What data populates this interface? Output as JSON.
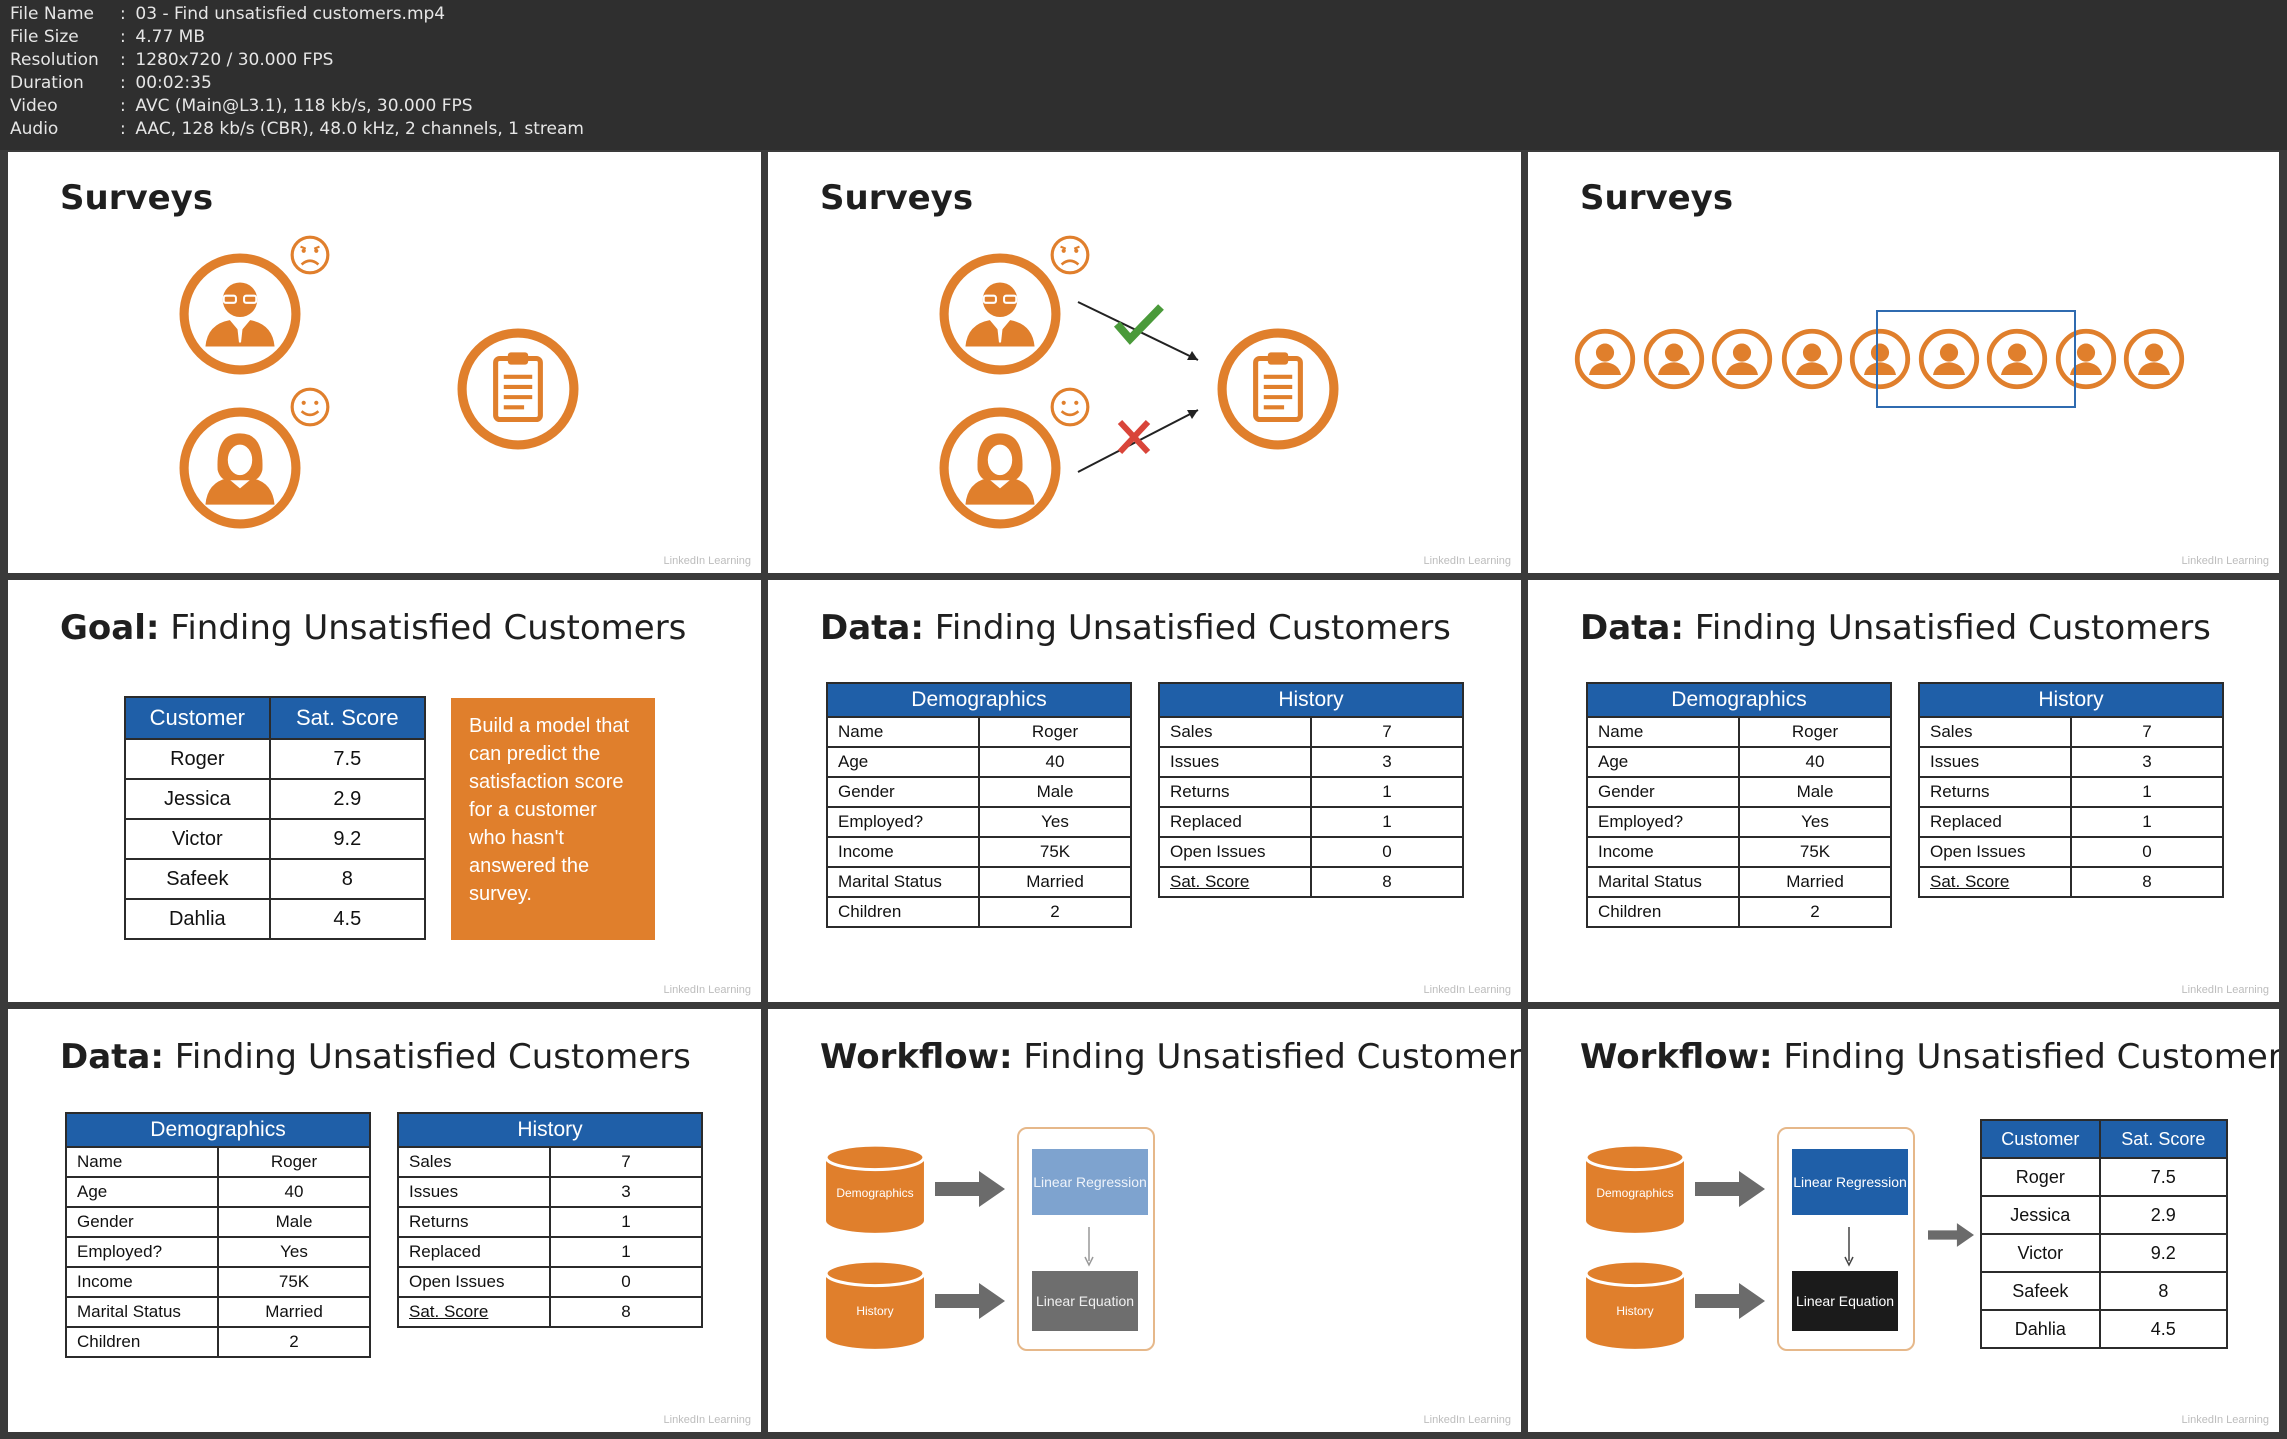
{
  "file_info": [
    {
      "key": "File Name",
      "value": "03 - Find unsatisfied customers.mp4"
    },
    {
      "key": "File Size",
      "value": "4.77 MB"
    },
    {
      "key": "Resolution",
      "value": "1280x720 / 30.000 FPS"
    },
    {
      "key": "Duration",
      "value": "00:02:35"
    },
    {
      "key": "Video",
      "value": "AVC (Main@L3.1), 118 kb/s, 30.000 FPS"
    },
    {
      "key": "Audio",
      "value": "AAC, 128 kb/s (CBR), 48.0 kHz, 2 channels, 1 stream"
    }
  ],
  "colors": {
    "accent_orange": "#e07f2c",
    "table_header_blue": "#1f5fa8",
    "check_green": "#4a9a3a",
    "cross_red": "#d9453a",
    "select_blue": "#2f6bb0"
  },
  "watermark": "LinkedIn Learning",
  "surveys": {
    "title": "Surveys"
  },
  "goal": {
    "title_bold": "Goal:",
    "title_rest": " Finding Unsatisfied Customers",
    "box_text": "Build a model that can predict the satisfaction score for a customer who hasn't answered the survey."
  },
  "data_title": {
    "bold": "Data:",
    "rest": " Finding Unsatisfied Customers"
  },
  "workflow_title": {
    "bold": "Workflow:",
    "rest": " Finding Unsatisfied Customers"
  },
  "customer_table": {
    "headers": [
      "Customer",
      "Sat. Score"
    ],
    "rows": [
      [
        "Roger",
        "7.5"
      ],
      [
        "Jessica",
        "2.9"
      ],
      [
        "Victor",
        "9.2"
      ],
      [
        "Safeek",
        "8"
      ],
      [
        "Dahlia",
        "4.5"
      ]
    ]
  },
  "demographics": {
    "header": "Demographics",
    "rows": [
      [
        "Name",
        "Roger"
      ],
      [
        "Age",
        "40"
      ],
      [
        "Gender",
        "Male"
      ],
      [
        "Employed?",
        "Yes"
      ],
      [
        "Income",
        "75K"
      ],
      [
        "Marital Status",
        "Married"
      ],
      [
        "Children",
        "2"
      ]
    ]
  },
  "history": {
    "header": "History",
    "rows": [
      [
        "Sales",
        "7"
      ],
      [
        "Issues",
        "3"
      ],
      [
        "Returns",
        "1"
      ],
      [
        "Replaced",
        "1"
      ],
      [
        "Open Issues",
        "0"
      ],
      [
        "Sat. Score",
        "8"
      ]
    ]
  },
  "workflow": {
    "demographics": "Demographics",
    "history": "History",
    "linear_regression": "Linear Regression",
    "linear_equation": "Linear Equation"
  },
  "icons": [
    "person-male-icon",
    "person-female-icon",
    "sad-face-icon",
    "happy-face-icon",
    "clipboard-icon",
    "check-icon",
    "cross-icon",
    "database-icon",
    "arrow-right-icon"
  ]
}
